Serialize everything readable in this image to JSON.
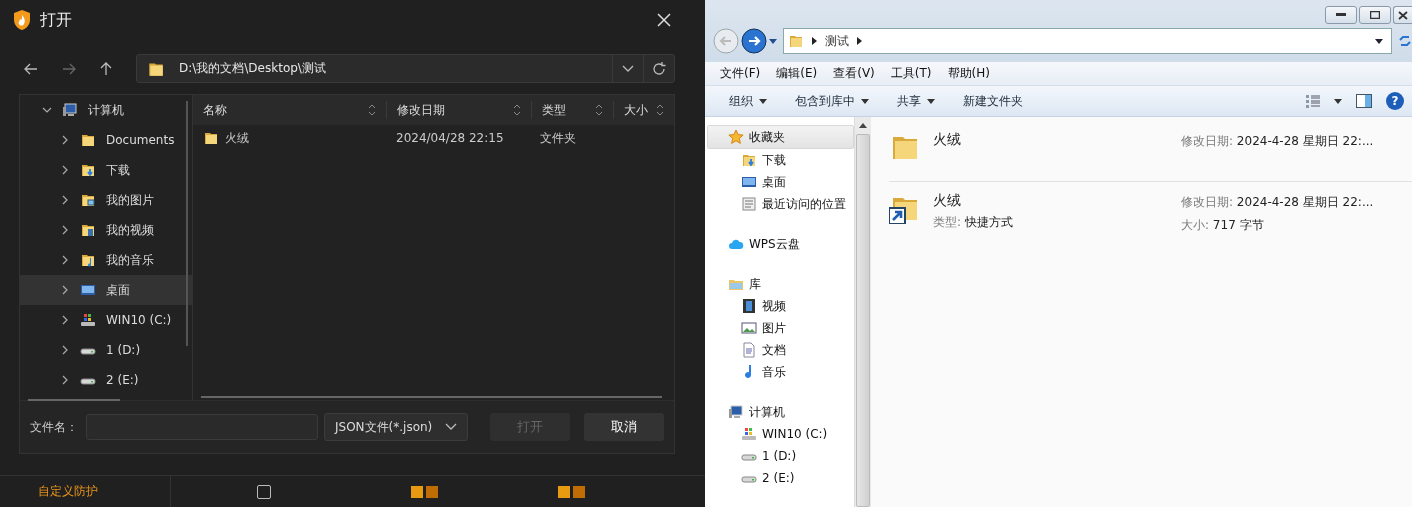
{
  "open_dialog": {
    "title": "打开",
    "path": "D:\\我的文档\\Desktop\\测试",
    "tree": [
      {
        "label": "计算机",
        "expanded": true,
        "selected": false,
        "children": [
          {
            "label": "Documents",
            "selected": false
          },
          {
            "label": "下载",
            "selected": false
          },
          {
            "label": "我的图片",
            "selected": false
          },
          {
            "label": "我的视频",
            "selected": false
          },
          {
            "label": "我的音乐",
            "selected": false
          },
          {
            "label": "桌面",
            "selected": true
          },
          {
            "label": "WIN10 (C:)",
            "selected": false
          },
          {
            "label": "1 (D:)",
            "selected": false
          },
          {
            "label": "2 (E:)",
            "selected": false
          }
        ]
      }
    ],
    "columns": [
      {
        "label": "名称"
      },
      {
        "label": "修改日期"
      },
      {
        "label": "类型"
      },
      {
        "label": "大小"
      }
    ],
    "rows": [
      {
        "name": "火绒",
        "modified": "2024/04/28 22:15",
        "type": "文件夹"
      }
    ],
    "filename_label": "文件名：",
    "filter": "JSON文件(*.json)",
    "buttons": [
      {
        "label": "打开",
        "disabled": true
      },
      {
        "label": "取消",
        "disabled": false
      }
    ]
  },
  "background_app": {
    "section_label": "自定义防护",
    "checkbox": {
      "checked": false
    }
  },
  "explorer": {
    "breadcrumb": "测试",
    "menu": [
      "文件(F)",
      "编辑(E)",
      "查看(V)",
      "工具(T)",
      "帮助(H)"
    ],
    "toolbar": [
      {
        "label": "组织",
        "dropdown": true
      },
      {
        "label": "包含到库中",
        "dropdown": true
      },
      {
        "label": "共享",
        "dropdown": true
      },
      {
        "label": "新建文件夹",
        "dropdown": false
      }
    ],
    "help_button": "?",
    "nav": [
      {
        "label": "收藏夹",
        "selected": true,
        "children": [
          {
            "label": "下载",
            "selected": false
          },
          {
            "label": "桌面",
            "selected": false
          },
          {
            "label": "最近访问的位置",
            "selected": false
          }
        ]
      },
      {
        "label": "WPS云盘",
        "selected": false
      },
      {
        "label": "库",
        "selected": false,
        "children": [
          {
            "label": "视频",
            "selected": false
          },
          {
            "label": "图片",
            "selected": false
          },
          {
            "label": "文档",
            "selected": false
          },
          {
            "label": "音乐",
            "selected": false
          }
        ]
      },
      {
        "label": "计算机",
        "selected": false,
        "children": [
          {
            "label": "WIN10 (C:)",
            "selected": false
          },
          {
            "label": "1 (D:)",
            "selected": false
          },
          {
            "label": "2 (E:)",
            "selected": false
          }
        ]
      }
    ],
    "files": [
      {
        "name": "火绒",
        "kind": "folder",
        "modified_label": "修改日期:",
        "modified": "2024-4-28 星期日 22:..."
      },
      {
        "name": "火绒",
        "kind": "shortcut",
        "type_label": "类型:",
        "type": "快捷方式",
        "modified_label": "修改日期:",
        "modified": "2024-4-28 星期日 22:...",
        "size_label": "大小:",
        "size": "717 字节"
      }
    ]
  }
}
